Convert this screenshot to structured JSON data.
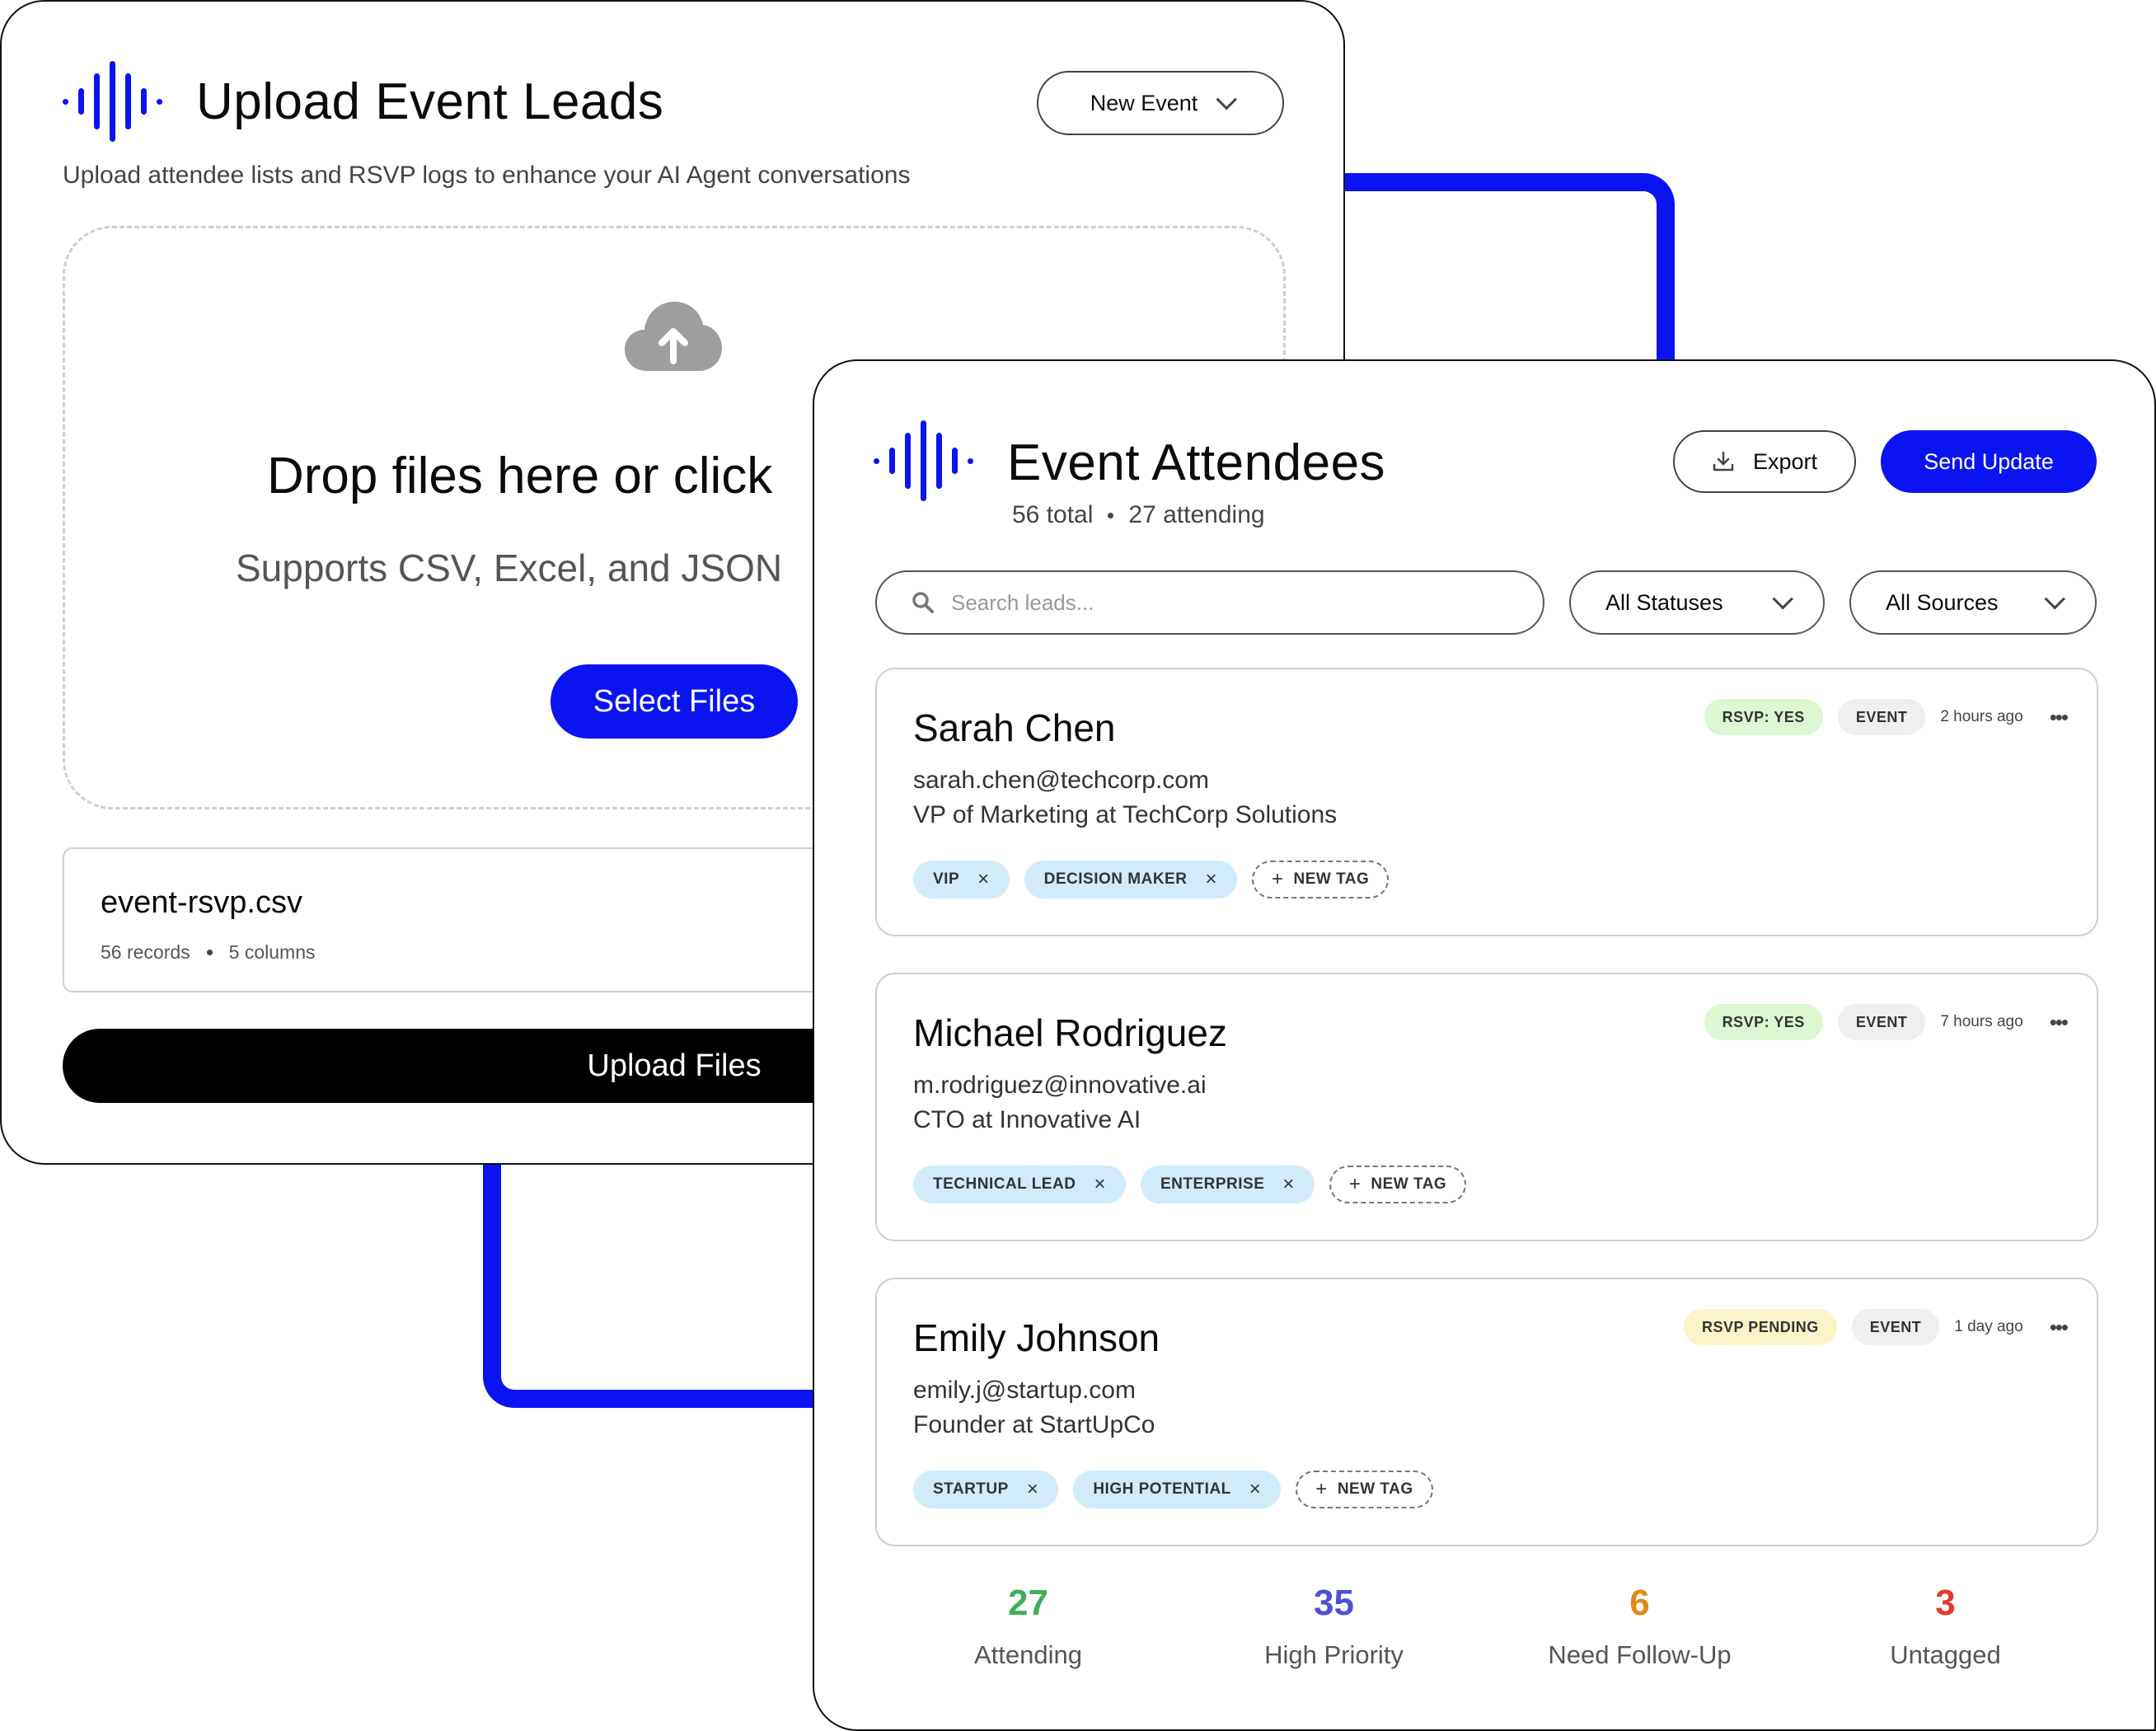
{
  "colors": {
    "accent": "#0a14f0",
    "attending": "#3fae5a",
    "high_priority": "#4f4fd6",
    "follow_up": "#e08a12",
    "untagged": "#e23b2e"
  },
  "upload": {
    "title": "Upload Event Leads",
    "subtitle": "Upload attendee lists and RSVP logs to enhance your AI Agent conversations",
    "event_select": "New Event",
    "drop_title": "Drop files here or click",
    "drop_sub": "Supports CSV, Excel, and JSON",
    "select_files": "Select Files",
    "file": {
      "name": "event-rsvp.csv",
      "records": "56 records",
      "columns": "5 columns"
    },
    "upload_button": "Upload Files",
    "icons": {
      "logo": "waveform-icon",
      "upload": "cloud-upload-icon"
    }
  },
  "attendees": {
    "title": "Event Attendees",
    "total": "56 total",
    "attending": "27 attending",
    "export": "Export",
    "send_update": "Send Update",
    "search_placeholder": "Search leads...",
    "status_filter": "All Statuses",
    "source_filter": "All Sources",
    "new_tag": "NEW TAG",
    "leads": [
      {
        "name": "Sarah Chen",
        "email": "sarah.chen@techcorp.com",
        "role": "VP of Marketing at TechCorp Solutions",
        "rsvp": "RSVP: YES",
        "source": "EVENT",
        "time": "2 hours ago",
        "tags": [
          "VIP",
          "DECISION MAKER"
        ]
      },
      {
        "name": "Michael Rodriguez",
        "email": "m.rodriguez@innovative.ai",
        "role": "CTO at Innovative AI",
        "rsvp": "RSVP: YES",
        "source": "EVENT",
        "time": "7 hours ago",
        "tags": [
          "TECHNICAL LEAD",
          "ENTERPRISE"
        ]
      },
      {
        "name": "Emily Johnson",
        "email": "emily.j@startup.com",
        "role": "Founder at StartUpCo",
        "rsvp": "RSVP PENDING",
        "source": "EVENT",
        "time": "1 day ago",
        "tags": [
          "STARTUP",
          "HIGH POTENTIAL"
        ]
      }
    ],
    "stats": [
      {
        "value": "27",
        "label": "Attending"
      },
      {
        "value": "35",
        "label": "High Priority"
      },
      {
        "value": "6",
        "label": "Need Follow-Up"
      },
      {
        "value": "3",
        "label": "Untagged"
      }
    ]
  }
}
